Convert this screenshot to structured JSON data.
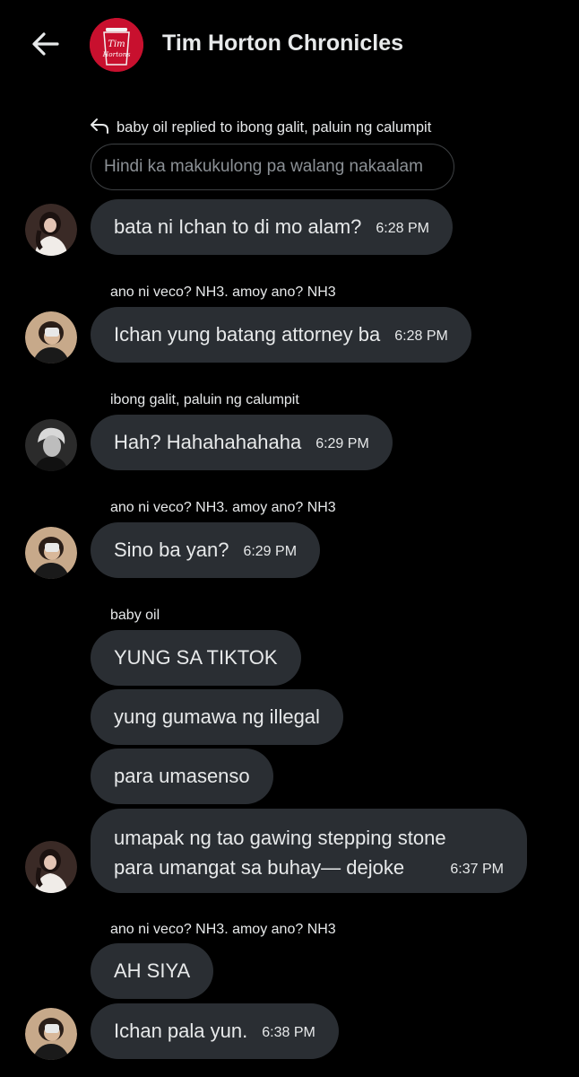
{
  "header": {
    "title": "Tim Horton Chronicles",
    "logo_text_1": "Tim",
    "logo_text_2": "Hortons",
    "brand_color": "#c8102e"
  },
  "reply": {
    "context": "baby oil replied to ibong galit, paluin ng calumpit",
    "quoted": "Hindi ka makukulong pa walang nakaalam"
  },
  "messages": [
    {
      "text": "bata ni Ichan to di mo alam?",
      "time": "6:28 PM"
    },
    {
      "sender": "ano ni veco? NH3. amoy ano? NH3",
      "text": "Ichan yung batang attorney ba",
      "time": "6:28 PM"
    },
    {
      "sender": "ibong galit, paluin ng calumpit",
      "text": "Hah? Hahahahahaha",
      "time": "6:29 PM"
    },
    {
      "sender": "ano ni veco? NH3. amoy ano? NH3",
      "text": "Sino ba yan?",
      "time": "6:29 PM"
    },
    {
      "sender": "baby oil",
      "text": "YUNG SA TIKTOK"
    },
    {
      "text": "yung gumawa ng illegal"
    },
    {
      "text": "para umasenso"
    },
    {
      "line1": "umapak ng tao gawing stepping stone",
      "line2": "para umangat sa buhay— dejoke",
      "time": "6:37 PM"
    },
    {
      "sender": "ano ni veco? NH3. amoy ano? NH3",
      "text": "AH SIYA"
    },
    {
      "text": "Ichan pala yun.",
      "time": "6:38 PM"
    }
  ]
}
